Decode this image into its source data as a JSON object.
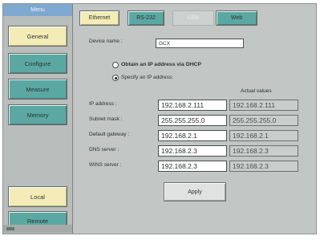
{
  "sidebar": {
    "title": "Menu",
    "items": [
      {
        "label": "General"
      },
      {
        "label": "Configure"
      },
      {
        "label": "Measure"
      },
      {
        "label": "Memory"
      }
    ],
    "local_label": "Local",
    "remote_label": "Remote"
  },
  "tabs": [
    {
      "label": "Ethernet"
    },
    {
      "label": "RS-232"
    },
    {
      "label": "USB"
    },
    {
      "label": "Web"
    }
  ],
  "form": {
    "device_name_label": "Device name :",
    "device_name_value": "GCX",
    "dhcp_option_label": "Obtain an IP address via DHCP",
    "static_option_label": "Specify an IP address:",
    "actual_values_header": "Actual values",
    "rows": [
      {
        "label": "IP address :",
        "value": "192.168.2.111",
        "actual": "192.168.2.111"
      },
      {
        "label": "Subnet mask :",
        "value": "255.255.255.0",
        "actual": "255.255.255.0"
      },
      {
        "label": "Default gateway :",
        "value": "192.168.2.1",
        "actual": "192.168.2.1"
      },
      {
        "label": "DNS server :",
        "value": "192.168.2.3",
        "actual": "192.168.2.3"
      },
      {
        "label": "WINS server :",
        "value": "192.168.2.3",
        "actual": "192.168.2.3"
      }
    ],
    "apply_label": "Apply"
  },
  "state": {
    "active_tab": "Ethernet",
    "active_menu": "General",
    "selected_ip_mode": "static"
  }
}
